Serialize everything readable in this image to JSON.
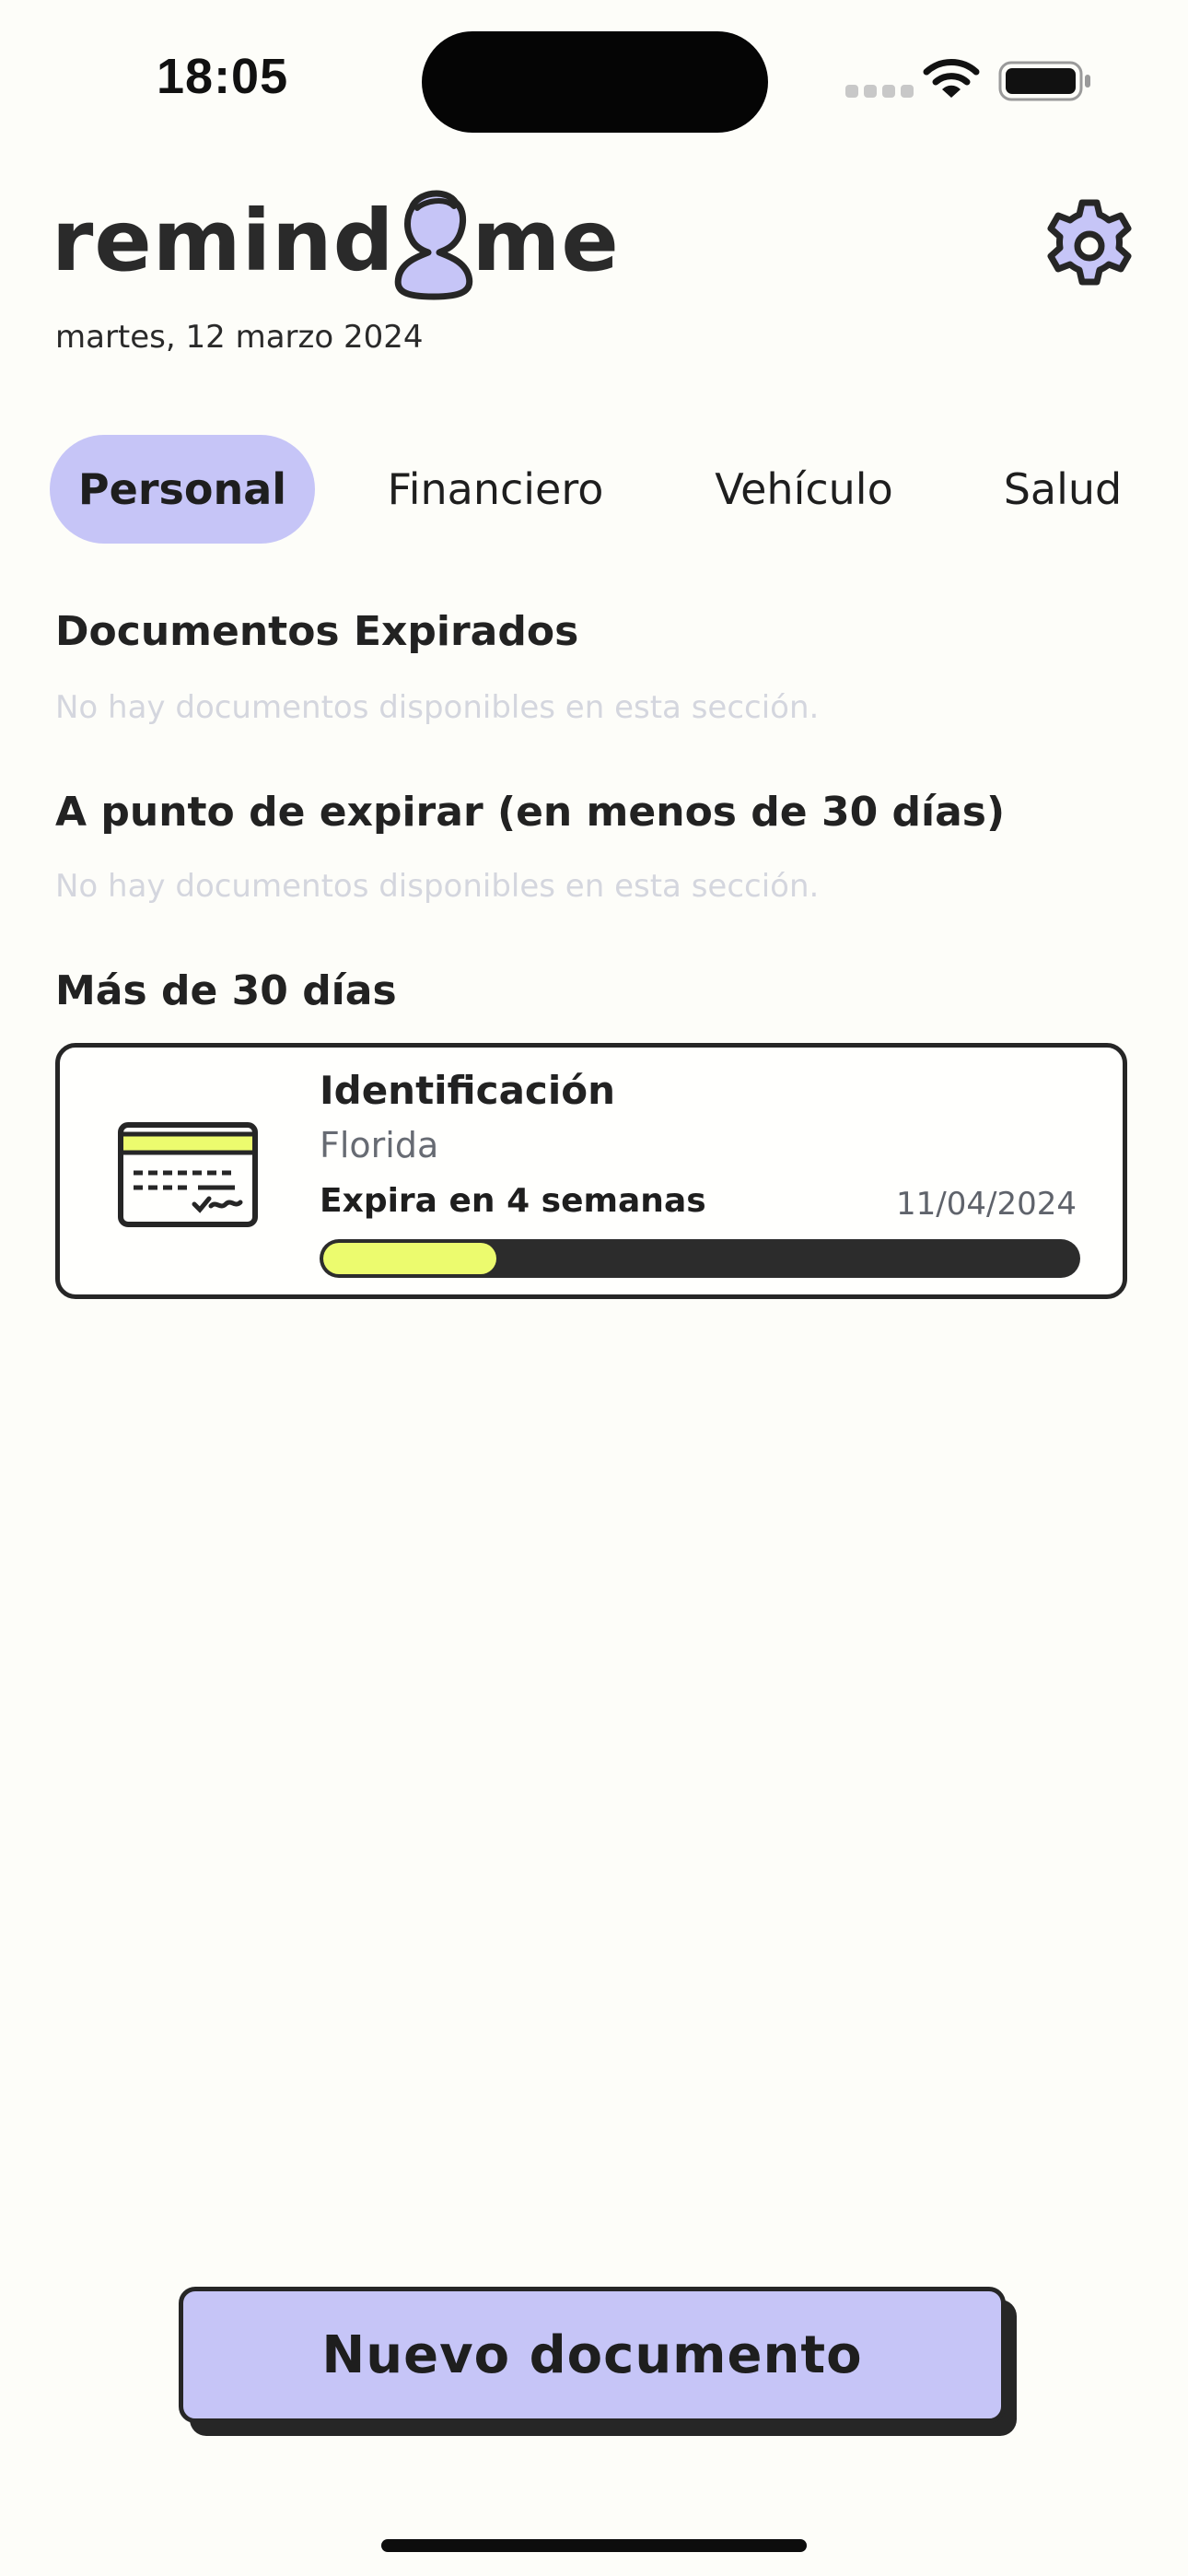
{
  "status_bar": {
    "time": "18:05"
  },
  "header": {
    "logo_left": "remind",
    "logo_right": "me",
    "date": "martes, 12 marzo 2024"
  },
  "tabs": [
    {
      "label": "Personal",
      "active": true
    },
    {
      "label": "Financiero",
      "active": false
    },
    {
      "label": "Vehículo",
      "active": false
    },
    {
      "label": "Salud",
      "active": false
    }
  ],
  "sections": {
    "expired": {
      "title": "Documentos Expirados",
      "empty_message": "No hay documentos disponibles en esta sección."
    },
    "expiring_soon": {
      "title": "A punto de expirar (en menos de 30 días)",
      "empty_message": "No hay documentos disponibles en esta sección."
    },
    "later": {
      "title": "Más de 30 días"
    }
  },
  "document": {
    "title": "Identificación",
    "location": "Florida",
    "expiry_text": "Expira en 4 semanas",
    "expiry_date": "11/04/2024",
    "progress": 0.23
  },
  "actions": {
    "new_document": "Nuevo documento"
  },
  "colors": {
    "accent": "#c6c5f7",
    "progress_fill": "#ecfb6e",
    "dark": "#262626",
    "background": "#fdfdf9"
  },
  "icons": {
    "settings": "gear-icon",
    "document": "id-card-icon",
    "logo_figure": "person-icon"
  }
}
